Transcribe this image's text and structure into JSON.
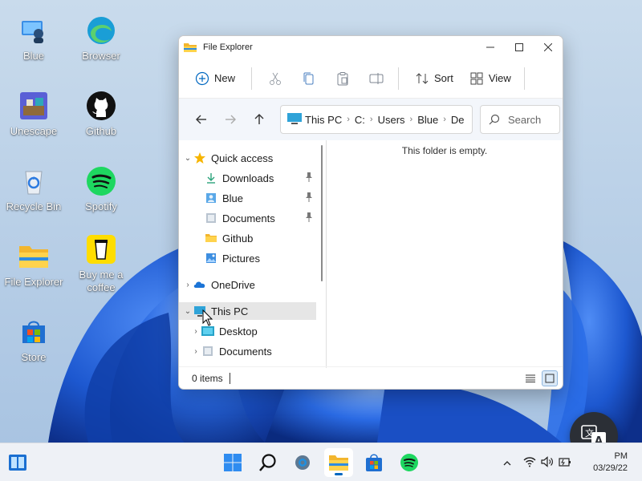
{
  "desktop": {
    "icons": [
      {
        "label": "Blue",
        "icon": "user-icon"
      },
      {
        "label": "Browser",
        "icon": "edge-icon"
      },
      {
        "label": "Unescape",
        "icon": "unescape-app-icon"
      },
      {
        "label": "Github",
        "icon": "github-icon"
      },
      {
        "label": "Recycle Bin",
        "icon": "recycle-bin-icon"
      },
      {
        "label": "Spotify",
        "icon": "spotify-icon"
      },
      {
        "label": "File Explorer",
        "icon": "folder-icon"
      },
      {
        "label": "Buy me a coffee",
        "icon": "coffee-cup-icon"
      },
      {
        "label": "Store",
        "icon": "store-icon"
      }
    ]
  },
  "window": {
    "title": "File Explorer",
    "command_bar": {
      "new_label": "New",
      "sort_label": "Sort",
      "view_label": "View"
    },
    "address": {
      "crumbs": [
        "This PC",
        "C:",
        "Users",
        "Blue",
        "De"
      ]
    },
    "search": {
      "placeholder": "Search"
    },
    "nav_pane": {
      "quick_access": "Quick access",
      "quick_items": [
        "Downloads",
        "Blue",
        "Documents",
        "Github",
        "Pictures"
      ],
      "onedrive": "OneDrive",
      "this_pc": "This PC",
      "this_pc_items": [
        "Desktop",
        "Documents"
      ]
    },
    "content": {
      "empty_message": "This folder is empty."
    },
    "status": {
      "item_count": "0 items"
    }
  },
  "taskbar": {
    "clock_time": "PM",
    "clock_date": "03/29/22"
  },
  "colors": {
    "accent": "#0067c0",
    "wallpaper_base": "#bcd3ea",
    "bloom": "#1f5fd6"
  }
}
